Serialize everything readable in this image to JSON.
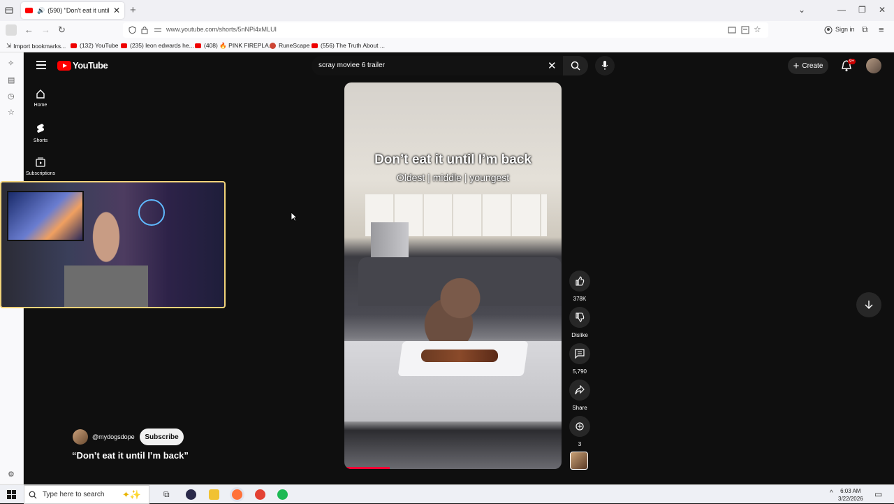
{
  "browser": {
    "tab_title": "(590) \"Don't eat it until I'm",
    "url": "www.youtube.com/shorts/5nNPi4xMLUI",
    "sign_in": "Sign in",
    "bookmarks": [
      {
        "label": "Import bookmarks...",
        "icon": "import-icon"
      },
      {
        "label": "(132) YouTube",
        "icon": "youtube-icon"
      },
      {
        "label": "(235) leon edwards he...",
        "icon": "youtube-icon"
      },
      {
        "label": "(408) 🔥 PINK FIREPLA...",
        "icon": "youtube-icon"
      },
      {
        "label": "RuneScape",
        "icon": "runescape-icon"
      },
      {
        "label": "(556) The Truth About ...",
        "icon": "youtube-icon"
      }
    ]
  },
  "youtube": {
    "logo_text": "YouTube",
    "search_value": "scray moviee 6 trailer",
    "create_label": "Create",
    "notif_badge": "9+",
    "nav": [
      {
        "label": "Home",
        "icon": "home-icon"
      },
      {
        "label": "Shorts",
        "icon": "shorts-icon"
      },
      {
        "label": "Subscriptions",
        "icon": "subscriptions-icon"
      }
    ],
    "video": {
      "overlay_title": "Don’t eat it until I’m back",
      "overlay_sub": "Oldest | middle | youngest",
      "progress": 0.21
    },
    "actions": {
      "likes": "378K",
      "dislike": "Dislike",
      "comments": "5,790",
      "share": "Share",
      "remix": "3"
    },
    "channel": {
      "handle": "@mydogsdope",
      "subscribe": "Subscribe",
      "short_title": "“Don’t eat it until I’m back”"
    }
  },
  "taskbar": {
    "search_placeholder": "Type here to search",
    "time": "6:03 AM",
    "date": "3/22/2026"
  },
  "colors": {
    "yt_red": "#ff0000",
    "bg_dark": "#0f0f0f",
    "webcam_border": "#f2d37a"
  }
}
